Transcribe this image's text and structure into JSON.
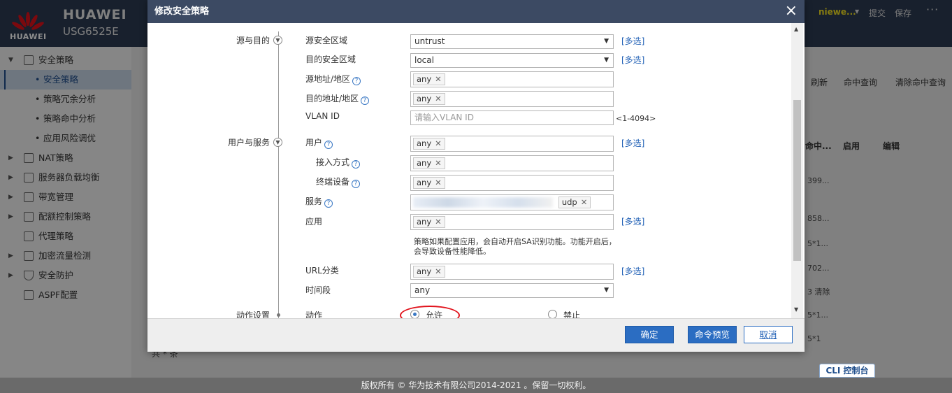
{
  "header": {
    "logo_text": "HUAWEI",
    "brand": "HUAWEI",
    "model": "USG6525E",
    "user": "niewe...",
    "user_caret": "▼",
    "submit": "提交",
    "save": "保存",
    "more": "···"
  },
  "sidebar": {
    "items": [
      {
        "label": "安全策略",
        "arrow": "▼"
      },
      {
        "label": "NAT策略",
        "arrow": "▶"
      },
      {
        "label": "服务器负载均衡",
        "arrow": "▶"
      },
      {
        "label": "带宽管理",
        "arrow": "▶"
      },
      {
        "label": "配额控制策略",
        "arrow": "▶"
      },
      {
        "label": "代理策略",
        "arrow": ""
      },
      {
        "label": "加密流量检测",
        "arrow": "▶"
      },
      {
        "label": "安全防护",
        "arrow": "▶"
      },
      {
        "label": "ASPF配置",
        "arrow": ""
      }
    ],
    "subitems": [
      {
        "label": "安全策略"
      },
      {
        "label": "策略冗余分析"
      },
      {
        "label": "策略命中分析"
      },
      {
        "label": "应用风险调优"
      }
    ]
  },
  "background": {
    "refresh": "刷新",
    "hit_query": "命中查询",
    "clear_hit": "清除命中查询",
    "col_hit": "命中...",
    "col_enable": "启用",
    "col_edit": "编辑",
    "cells": [
      "399...",
      "858...",
      "5*1...",
      "702...",
      "3 清除",
      "5*1...",
      "5*1"
    ],
    "bottom_partial": "共 * 条",
    "cli": "CLI 控制台"
  },
  "footer": "版权所有 © 华为技术有限公司2014-2021 。保留一切权利。",
  "dialog": {
    "title": "修改安全策略",
    "sections": {
      "source_dest": "源与目的",
      "user_service": "用户与服务",
      "action_settings": "动作设置"
    },
    "labels": {
      "src_zone": "源安全区域",
      "dst_zone": "目的安全区域",
      "src_addr": "源地址/地区",
      "dst_addr": "目的地址/地区",
      "vlan": "VLAN ID",
      "user": "用户",
      "access": "接入方式",
      "terminal": "终端设备",
      "service": "服务",
      "application": "应用",
      "url": "URL分类",
      "time": "时间段",
      "action": "动作"
    },
    "values": {
      "src_zone": "untrust",
      "dst_zone": "local",
      "any": "any",
      "vlan_placeholder": "请输入VLAN ID",
      "vlan_range": "<1-4094>",
      "service_tag": "udp",
      "time": "any"
    },
    "multi_select": "[多选]",
    "app_note": "策略如果配置应用，会自动开启SA识别功能。功能开启后，会导致设备性能降低。",
    "action_allow": "允许",
    "action_deny": "禁止",
    "buttons": {
      "ok": "确定",
      "preview": "命令预览",
      "cancel": "取消"
    }
  }
}
